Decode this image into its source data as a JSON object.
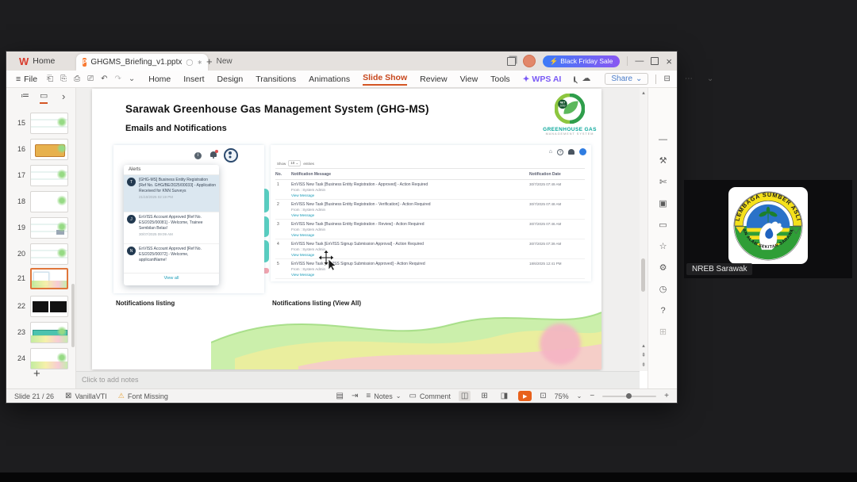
{
  "app": {
    "home_tab": "Home",
    "doc_tab": "GHGMS_Briefing_v1.pptx",
    "new_tab": "New",
    "sale_button": "Black Friday Sale",
    "menus": [
      "File",
      "Home",
      "Insert",
      "Design",
      "Transitions",
      "Animations",
      "Slide Show",
      "Review",
      "View",
      "Tools",
      "WPS AI"
    ],
    "share_label": "Share"
  },
  "icons": {
    "wps_logo": "W",
    "doc_badge": "P",
    "sync": "◯",
    "modified": "∗",
    "bolt": "⚡",
    "minimize": "—",
    "close": "×",
    "hamburger": "≡",
    "save": "⎗",
    "copy": "⎘",
    "print": "⎙",
    "preview": "⎚",
    "undo": "↶",
    "redo": "↷",
    "chev": "⌄",
    "sparkle": "✦",
    "cloud": "☁",
    "panel": "⊟",
    "more": "⋯",
    "outline_tab": "≔",
    "slides_tab": "▭",
    "collapse": "›",
    "plus": "+",
    "scroll_up": "▴",
    "page_up": "⇞",
    "page_down": "⇟",
    "side_tools": [
      "—",
      "⚒",
      "✄",
      "▣",
      "▭",
      "☆",
      "⚙",
      "◷",
      "?",
      "⊞"
    ],
    "mini_home": "⌂",
    "mini_help": "?",
    "status_note": "▤",
    "status_jump": "⇥",
    "view_normal": "◫",
    "view_sorter": "⊞",
    "view_read": "◨",
    "play": "▶",
    "fit": "⊡",
    "minus": "−",
    "warn": "⚠",
    "theme": "⊠"
  },
  "thumbs": {
    "numbers": [
      "15",
      "16",
      "17",
      "18",
      "19",
      "20",
      "21",
      "22",
      "23",
      "24"
    ],
    "selected": "21"
  },
  "slide": {
    "title": "Sarawak Greenhouse Gas Management System (GHG-MS)",
    "subtitle": "Emails and Notifications",
    "logo": {
      "line1": "GREENHOUSE GAS",
      "line2": "MANAGEMENT SYSTEM",
      "badge_top": "NET",
      "badge_bottom": "2050"
    },
    "caption_left": "Notifications listing",
    "caption_right": "Notifications listing (View All)",
    "alerts": {
      "header": "Alerts",
      "view_all": "View all",
      "items": [
        {
          "avatar": "T",
          "text": "[GHG-MS] Business Entity Registration [Ref No. GHG/BE/2025/00033] - Application Received for KNN Surveys",
          "date": "21/10/2025 02:19 PM"
        },
        {
          "avatar": "J",
          "text": "EnVISS Account Approved [Ref No. ES/2025/00081] - Welcome, Trainee Sembilan Belas!",
          "date": "30/07/2025 09:09 AM"
        },
        {
          "avatar": "N",
          "text": "EnVISS Account Approved [Ref No. ES/2025/00072] - Welcome, applicantName!",
          "date": ""
        }
      ]
    },
    "table": {
      "show_label": "Show",
      "page_size": "10",
      "entries_label": "entries",
      "headers": [
        "No.",
        "Notification Message",
        "Notification Date"
      ],
      "from_label": "From : System Admin",
      "link_label": "View Message",
      "rows": [
        {
          "no": "1",
          "message": "EnVISS New Task [Business Entity Registration - Approved] - Action Required",
          "date": "30/7/2025 07:49 AM"
        },
        {
          "no": "2",
          "message": "EnVISS New Task [Business Entity Registration - Verification] - Action Required",
          "date": "30/7/2025 07:48 AM"
        },
        {
          "no": "3",
          "message": "EnVISS New Task [Business Entity Registration - Review] - Action Required",
          "date": "30/7/2025 07:46 AM"
        },
        {
          "no": "4",
          "message": "EnVISS New Task [EnVISS Signup Submission Approval] - Action Required",
          "date": "30/7/2025 07:39 AM"
        },
        {
          "no": "5",
          "message": "EnVISS New Task [EnVISS Signup Submission Approved] - Action Required",
          "date": "18/6/2025 12:41 PM"
        }
      ]
    }
  },
  "notes_placeholder": "Click to add notes",
  "status": {
    "slide_info": "Slide 21 / 26",
    "theme": "VanillaVTI",
    "font_missing": "Font Missing",
    "notes": "Notes",
    "comment": "Comment",
    "zoom": "75%"
  },
  "webcam": {
    "name": "NREB Sarawak",
    "arc_top": "LEMBAGA SUMBER ASLI",
    "arc_bottom": "DAN ALAM SEKITAR SARAWAK"
  }
}
